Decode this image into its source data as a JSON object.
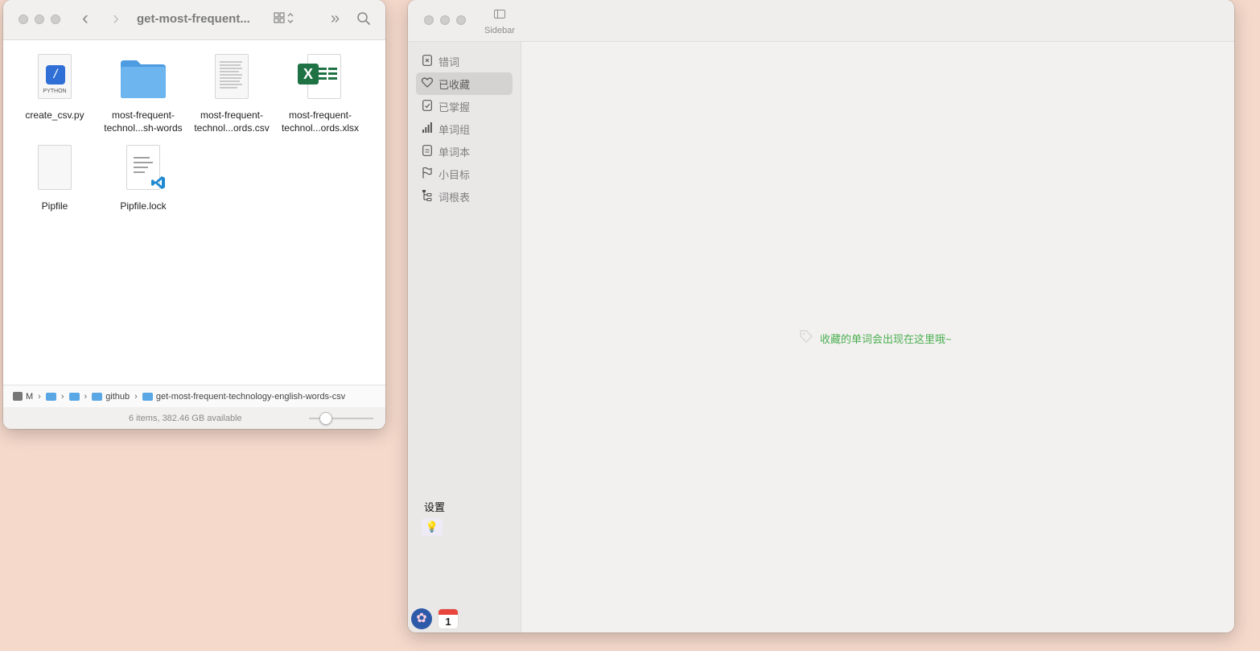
{
  "finder": {
    "title": "get-most-frequent...",
    "toolbar": {
      "back_icon": "chevron-left-icon",
      "forward_icon": "chevron-right-icon",
      "view_icon": "grid-view-icon",
      "more_icon": "double-chevron-icon",
      "search_icon": "search-icon"
    },
    "files": [
      {
        "name": "create_csv.py",
        "label_line1": "create_csv.py",
        "label_line2": "",
        "kind": "python",
        "badge": "PYTHON"
      },
      {
        "name": "most-frequent-technol...sh-words",
        "label_line1": "most-frequent-",
        "label_line2": "technol...sh-words",
        "kind": "folder"
      },
      {
        "name": "most-frequent-technol...ords.csv",
        "label_line1": "most-frequent-",
        "label_line2": "technol...ords.csv",
        "kind": "csv"
      },
      {
        "name": "most-frequent-technol...ords.xlsx",
        "label_line1": "most-frequent-",
        "label_line2": "technol...ords.xlsx",
        "kind": "xlsx",
        "badge": "X"
      },
      {
        "name": "Pipfile",
        "label_line1": "Pipfile",
        "label_line2": "",
        "kind": "blank"
      },
      {
        "name": "Pipfile.lock",
        "label_line1": "Pipfile.lock",
        "label_line2": "",
        "kind": "vscode"
      }
    ],
    "path": {
      "root": "M",
      "folder_a": "",
      "folder_b": "",
      "github": "github",
      "current": "get-most-frequent-technology-english-words-csv",
      "separator": "›"
    },
    "status": "6 items, 382.46 GB available",
    "zoom_level": 0.3
  },
  "app": {
    "sidebar_toggle_label": "Sidebar",
    "nav": [
      {
        "label": "错词",
        "icon": "x-doc-icon"
      },
      {
        "label": "已收藏",
        "icon": "heart-icon",
        "selected": true
      },
      {
        "label": "已掌握",
        "icon": "check-doc-icon"
      },
      {
        "label": "单词组",
        "icon": "bars-icon"
      },
      {
        "label": "单词本",
        "icon": "notebook-icon"
      },
      {
        "label": "小目标",
        "icon": "flag-icon"
      },
      {
        "label": "词根表",
        "icon": "tree-icon"
      }
    ],
    "settings_label": "设置",
    "calendar_day": "1",
    "empty_message": "收藏的单词会出现在这里哦~"
  },
  "colors": {
    "desktop": "#f5d9cb",
    "accent_green": "#4caf50",
    "folder_blue": "#5aa7e5",
    "excel_green": "#1f7244",
    "python_blue": "#2f6fd6"
  }
}
